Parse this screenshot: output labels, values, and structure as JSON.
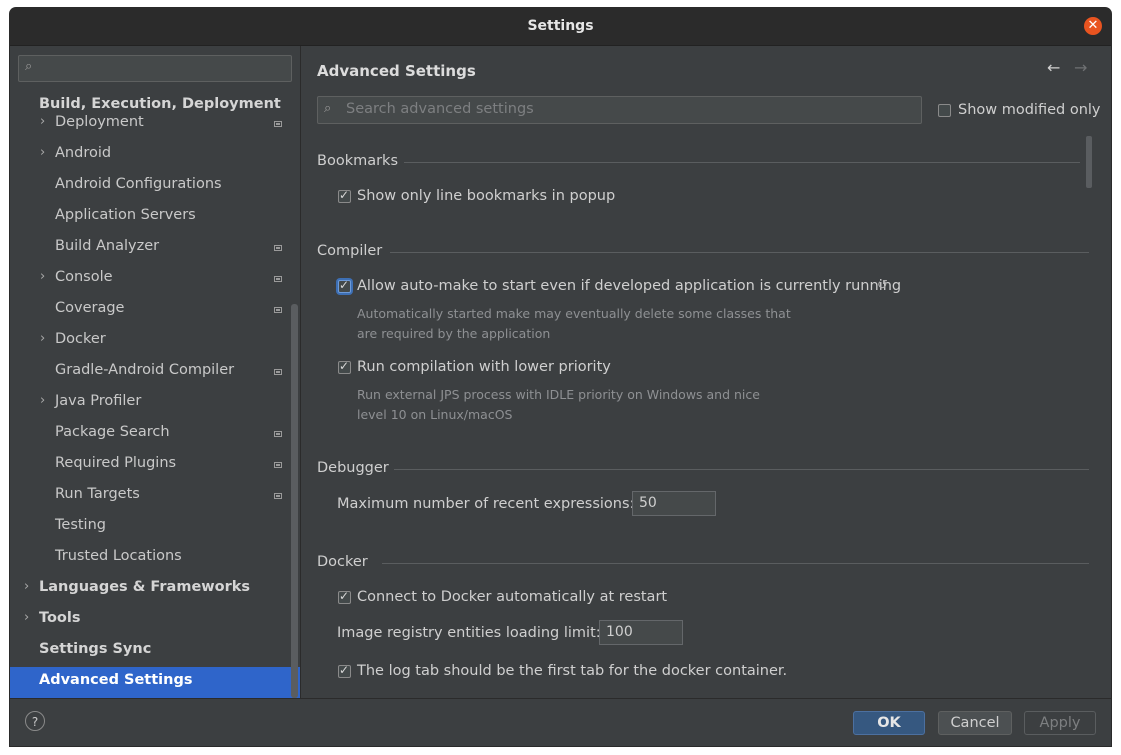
{
  "window": {
    "title": "Settings"
  },
  "sidebar": {
    "search_placeholder": "",
    "group_build": "Build, Execution, Deployment",
    "items": [
      {
        "label": "Deployment",
        "expandable": true,
        "modified": true
      },
      {
        "label": "Android",
        "expandable": true,
        "modified": false
      },
      {
        "label": "Android Configurations",
        "expandable": false,
        "modified": false
      },
      {
        "label": "Application Servers",
        "expandable": false,
        "modified": false
      },
      {
        "label": "Build Analyzer",
        "expandable": false,
        "modified": true
      },
      {
        "label": "Console",
        "expandable": true,
        "modified": true
      },
      {
        "label": "Coverage",
        "expandable": false,
        "modified": true
      },
      {
        "label": "Docker",
        "expandable": true,
        "modified": false
      },
      {
        "label": "Gradle-Android Compiler",
        "expandable": false,
        "modified": true
      },
      {
        "label": "Java Profiler",
        "expandable": true,
        "modified": false
      },
      {
        "label": "Package Search",
        "expandable": false,
        "modified": true
      },
      {
        "label": "Required Plugins",
        "expandable": false,
        "modified": true
      },
      {
        "label": "Run Targets",
        "expandable": false,
        "modified": true
      },
      {
        "label": "Testing",
        "expandable": false,
        "modified": false
      },
      {
        "label": "Trusted Locations",
        "expandable": false,
        "modified": false
      }
    ],
    "top_level": [
      {
        "label": "Languages & Frameworks",
        "expandable": true
      },
      {
        "label": "Tools",
        "expandable": true
      },
      {
        "label": "Settings Sync",
        "expandable": false
      },
      {
        "label": "Advanced Settings",
        "expandable": false,
        "selected": true
      }
    ]
  },
  "content": {
    "title": "Advanced Settings",
    "search_placeholder": "Search advanced settings",
    "show_modified_label": "Show modified only",
    "show_modified_checked": false,
    "sections": {
      "bookmarks": {
        "title": "Bookmarks",
        "option": {
          "label": "Show only line bookmarks in popup",
          "checked": true
        }
      },
      "compiler": {
        "title": "Compiler",
        "automake": {
          "label": "Allow auto-make to start even if developed application is currently running",
          "checked": true,
          "desc1": "Automatically started make may eventually delete some classes that",
          "desc2": "are required by the application"
        },
        "lowprio": {
          "label": "Run compilation with lower priority",
          "checked": true,
          "desc1": "Run external JPS process with IDLE priority on Windows and nice",
          "desc2": "level 10 on Linux/macOS"
        }
      },
      "debugger": {
        "title": "Debugger",
        "max_label": "Maximum number of recent expressions:",
        "max_value": "50"
      },
      "docker": {
        "title": "Docker",
        "connect": {
          "label": "Connect to Docker automatically at restart",
          "checked": true
        },
        "limit_label": "Image registry entities loading limit:",
        "limit_value": "100",
        "logtab": {
          "label": "The log tab should be the first tab for the docker container.",
          "checked": true
        }
      }
    }
  },
  "footer": {
    "help": "?",
    "ok": "OK",
    "cancel": "Cancel",
    "apply": "Apply"
  },
  "colors": {
    "accent": "#2f65ca",
    "close": "#e95420",
    "background": "#3c3f41"
  }
}
